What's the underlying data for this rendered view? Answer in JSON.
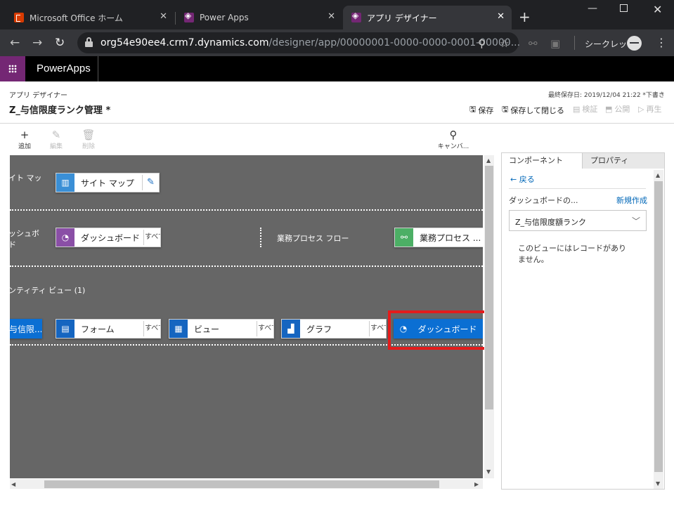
{
  "browser": {
    "tabs": [
      {
        "title": "Microsoft Office ホーム",
        "icon": "office-icon"
      },
      {
        "title": "Power Apps",
        "icon": "powerapps-icon"
      },
      {
        "title": "アプリ デザイナー",
        "icon": "powerapps-icon"
      }
    ],
    "url_host": "org54e90ee4.crm7.dynamics.com",
    "url_path": "/designer/app/00000001-0000-0000-0001-00000...",
    "incognito_label": "シークレット"
  },
  "powerapps": {
    "brand": "PowerApps"
  },
  "designer": {
    "label": "アプリ デザイナー",
    "app_name": "Z_与信限度ランク管理 *",
    "last_saved": "最終保存日: 2019/12/04 21:22 *下書き",
    "commands": {
      "save": "保存",
      "save_close": "保存して閉じる",
      "validate": "検証",
      "publish": "公開",
      "play": "再生"
    },
    "ribbon": {
      "add": "追加",
      "edit": "編集",
      "delete": "削除",
      "canvas": "キャンバ..."
    }
  },
  "canvas": {
    "sitemap_row_label": "イト マッ",
    "sitemap_tile": "サイト マップ",
    "dashboard_row_label_1": "ッシュボ",
    "dashboard_row_label_2": "ド",
    "dashboard_tile": "ダッシュボード",
    "scope_all": "すべて",
    "bpf_label": "業務プロセス フロー",
    "bpf_tile": "業務プロセス ...",
    "entity_view_label": "ンティティ ビュー (1)",
    "entity_tile": "与信限...",
    "form_tile": "フォーム",
    "view_tile": "ビュー",
    "chart_tile": "グラフ",
    "selected_dashboard_tile": "ダッシュボード"
  },
  "panel": {
    "tabs": [
      "コンポーネント",
      "プロパティ"
    ],
    "back": "戻る",
    "dashboard_label": "ダッシュボードの...",
    "new_link": "新規作成",
    "selected_view": "Z_与信限度額ランク",
    "no_records": "このビューにはレコードがありません。"
  }
}
